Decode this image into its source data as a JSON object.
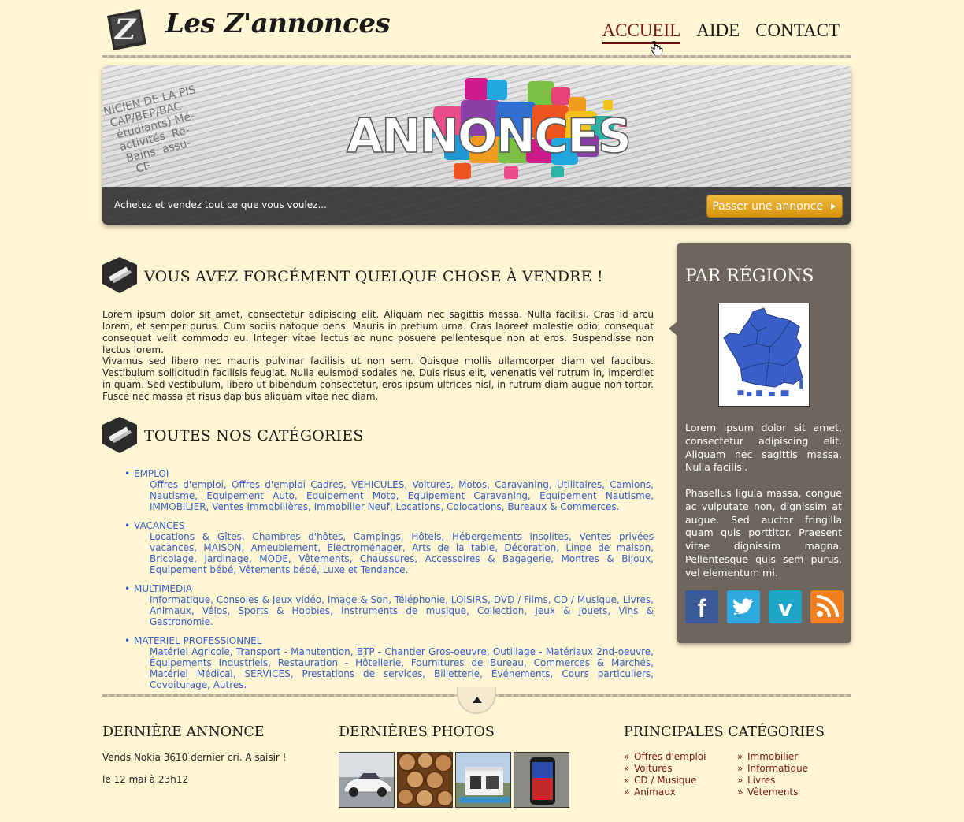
{
  "header": {
    "site_title": "Les Z'annonces",
    "nav": [
      {
        "label": "ACCUEIL",
        "active": true
      },
      {
        "label": "AIDE",
        "active": false
      },
      {
        "label": "CONTACT",
        "active": false
      }
    ]
  },
  "banner": {
    "headline": "ANNONCES",
    "tagline": "Achetez et vendez tout ce que vous voulez...",
    "cta_label": "Passer une annonce"
  },
  "intro": {
    "title": "VOUS AVEZ FORCÉMENT QUELQUE CHOSE À VENDRE !",
    "p1": "Lorem ipsum dolor sit amet, consectetur adipiscing elit. Aliquam nec sagittis massa. Nulla facilisi. Cras id arcu lorem, et semper purus. Cum sociis natoque pens. Mauris in pretium urna. Cras laoreet molestie odio, consequat consequat velit commodo eu. Integer vitae lectus ac nunc posuere pellentesque non at eros. Suspendisse non lectus lorem.",
    "p2": "Vivamus sed libero nec mauris pulvinar facilisis ut non sem. Quisque mollis ullamcorper diam vel faucibus. Vestibulum sollicitudin facilisis feugiat. Nulla euismod sodales he. Duis risus elit, venenatis vel rutrum in, imperdiet in quam. Sed vestibulum, libero ut bibendum consectetur, eros ipsum ultrices nisl, in rutrum diam augue non tortor. Fusce nec massa et risus dapibus aliquam vitae nec diam."
  },
  "categories": {
    "title": "TOUTES NOS CATÉGORIES",
    "items": [
      {
        "name": "EMPLOI",
        "links": "Offres d'emploi, Offres d'emploi Cadres, VEHICULES, Voitures, Motos, Caravaning, Utilitaires, Camions, Nautisme, Equipement Auto, Equipement Moto, Equipement Caravaning, Equipement Nautisme, IMMOBILIER, Ventes immobilières, Immobilier Neuf, Locations, Colocations, Bureaux & Commerces."
      },
      {
        "name": "VACANCES",
        "links": "Locations & Gîtes, Chambres d'hôtes, Campings, Hôtels, Hébergements insolites, Ventes privées vacances, MAISON, Ameublement, Electroménager, Arts de la table, Décoration, Linge de maison, Bricolage, Jardinage, MODE, Vêtements, Chaussures, Accessoires & Bagagerie, Montres & Bijoux, Equipement bébé, Vêtements bébé, Luxe et Tendance."
      },
      {
        "name": "MULTIMEDIA",
        "links": "Informatique, Consoles & Jeux vidéo, Image & Son, Téléphonie, LOISIRS, DVD / Films, CD / Musique, Livres, Animaux, Vélos, Sports & Hobbies, Instruments de musique, Collection, Jeux & Jouets, Vins & Gastronomie."
      },
      {
        "name": "MATERIEL PROFESSIONNEL",
        "links": "Matériel Agricole, Transport - Manutention, BTP - Chantier Gros-oeuvre, Outillage - Matériaux 2nd-oeuvre, Équipements Industriels, Restauration - Hôtellerie, Fournitures de Bureau, Commerces & Marchés, Matériel Médical, SERVICES, Prestations de services, Billetterie, Evénements, Cours particuliers, Covoiturage, Autres."
      }
    ]
  },
  "sidebar": {
    "title": "PAR RÉGIONS",
    "p1": "Lorem ipsum dolor sit amet, consectetur adipiscing elit. Aliquam nec sagittis massa. Nulla facilisi.",
    "p2": "Phasellus ligula massa, congue ac vulputate non, dignissim at augue. Sed auctor fringilla quam quis porttitor. Praesent vitae dignissim magna. Pellentesque quis sem purus, vel elementum mi.",
    "socials": [
      "facebook-icon",
      "twitter-icon",
      "vimeo-icon",
      "rss-icon"
    ],
    "colors": {
      "facebook": "#3b5998",
      "twitter": "#2ea9e0",
      "vimeo": "#1ea6c6",
      "rss": "#f0801d",
      "map": "#3a5fc8"
    }
  },
  "footer": {
    "last_ad_title": "DERNIÈRE ANNONCE",
    "last_ad_text": "Vends Nokia 3610 dernier cri. A saisir !",
    "last_ad_date": "le 12 mai à 23h12",
    "photos_title": "DERNIÈRES PHOTOS",
    "main_cats_title": "PRINCIPALES CATÉGORIES",
    "main_cats_col1": [
      "Offres d'emploi",
      "Voitures",
      "CD / Musique",
      "Animaux"
    ],
    "main_cats_col2": [
      "Immobilier",
      "Informatique",
      "Livres",
      "Vêtements"
    ]
  }
}
